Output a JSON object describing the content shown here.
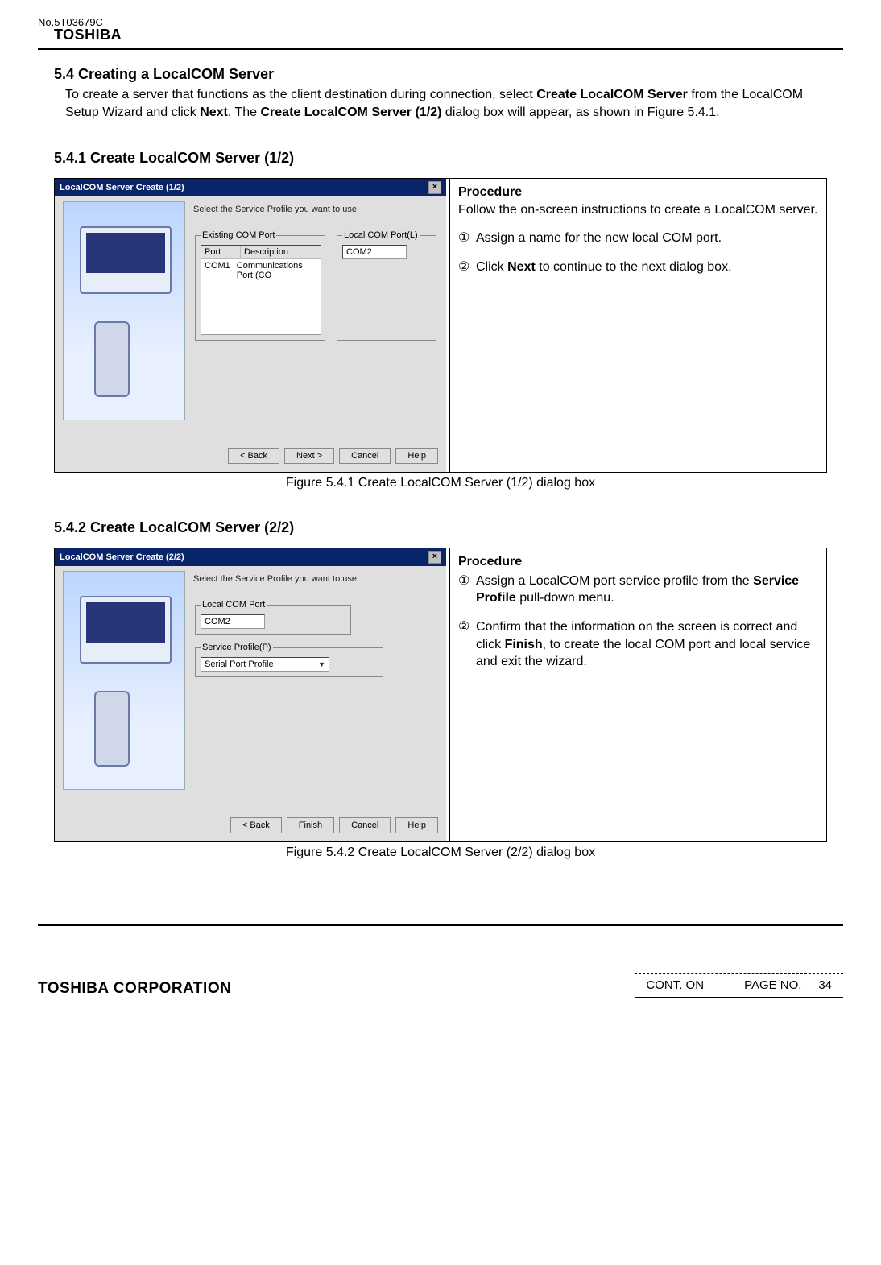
{
  "doc_no": "No.5T03679C",
  "brand": "TOSHIBA",
  "section": {
    "title": "5.4 Creating a LocalCOM Server",
    "intro_parts": [
      "To create a server that functions as the client destination during connection, select ",
      "Create LocalCOM Server",
      " from the LocalCOM Setup Wizard and click ",
      "Next",
      ". The ",
      "Create LocalCOM Server (1/2)",
      " dialog box will appear, as shown in Figure 5.4.1."
    ]
  },
  "sub1": {
    "title": "5.4.1 Create LocalCOM Server (1/2)",
    "dialog": {
      "title": "LocalCOM Server Create (1/2)",
      "hint": "Select the Service Profile you want to use.",
      "existing_group": "Existing COM Port",
      "local_group": "Local COM Port(L)",
      "col_port": "Port",
      "col_desc": "Description",
      "row_port": "COM1",
      "row_desc": "Communications Port (CO",
      "local_value": "COM2",
      "btn_back": "< Back",
      "btn_next": "Next >",
      "btn_cancel": "Cancel",
      "btn_help": "Help"
    },
    "procedure_title": "Procedure",
    "procedure_intro": "Follow the on-screen instructions to create a LocalCOM server.",
    "step1_num": "①",
    "step1": "Assign a name for the new local COM port.",
    "step2_num": "②",
    "step2_pre": "Click ",
    "step2_bold": "Next",
    "step2_post": " to continue to the next dialog box.",
    "caption": "Figure 5.4.1 Create LocalCOM Server (1/2) dialog box"
  },
  "sub2": {
    "title": "5.4.2 Create LocalCOM Server (2/2)",
    "dialog": {
      "title": "LocalCOM Server Create (2/2)",
      "hint": "Select the Service Profile you want to use.",
      "local_group": "Local COM Port",
      "local_value": "COM2",
      "service_group": "Service Profile(P)",
      "service_value": "Serial Port Profile",
      "btn_back": "< Back",
      "btn_finish": "Finish",
      "btn_cancel": "Cancel",
      "btn_help": "Help"
    },
    "procedure_title": "Procedure",
    "step1_num": "①",
    "step1_pre": "Assign a LocalCOM port service profile from the ",
    "step1_bold": "Service Profile",
    "step1_post": " pull-down menu.",
    "step2_num": "②",
    "step2_pre": "Confirm that the information on the screen is correct and click ",
    "step2_bold": "Finish",
    "step2_post": ", to create the local COM port and local service and exit the wizard.",
    "caption": "Figure 5.4.2 Create LocalCOM Server (2/2) dialog box"
  },
  "footer": {
    "corp": "TOSHIBA CORPORATION",
    "cont": "CONT. ON",
    "page_label": "PAGE NO.",
    "page_no": "34"
  }
}
